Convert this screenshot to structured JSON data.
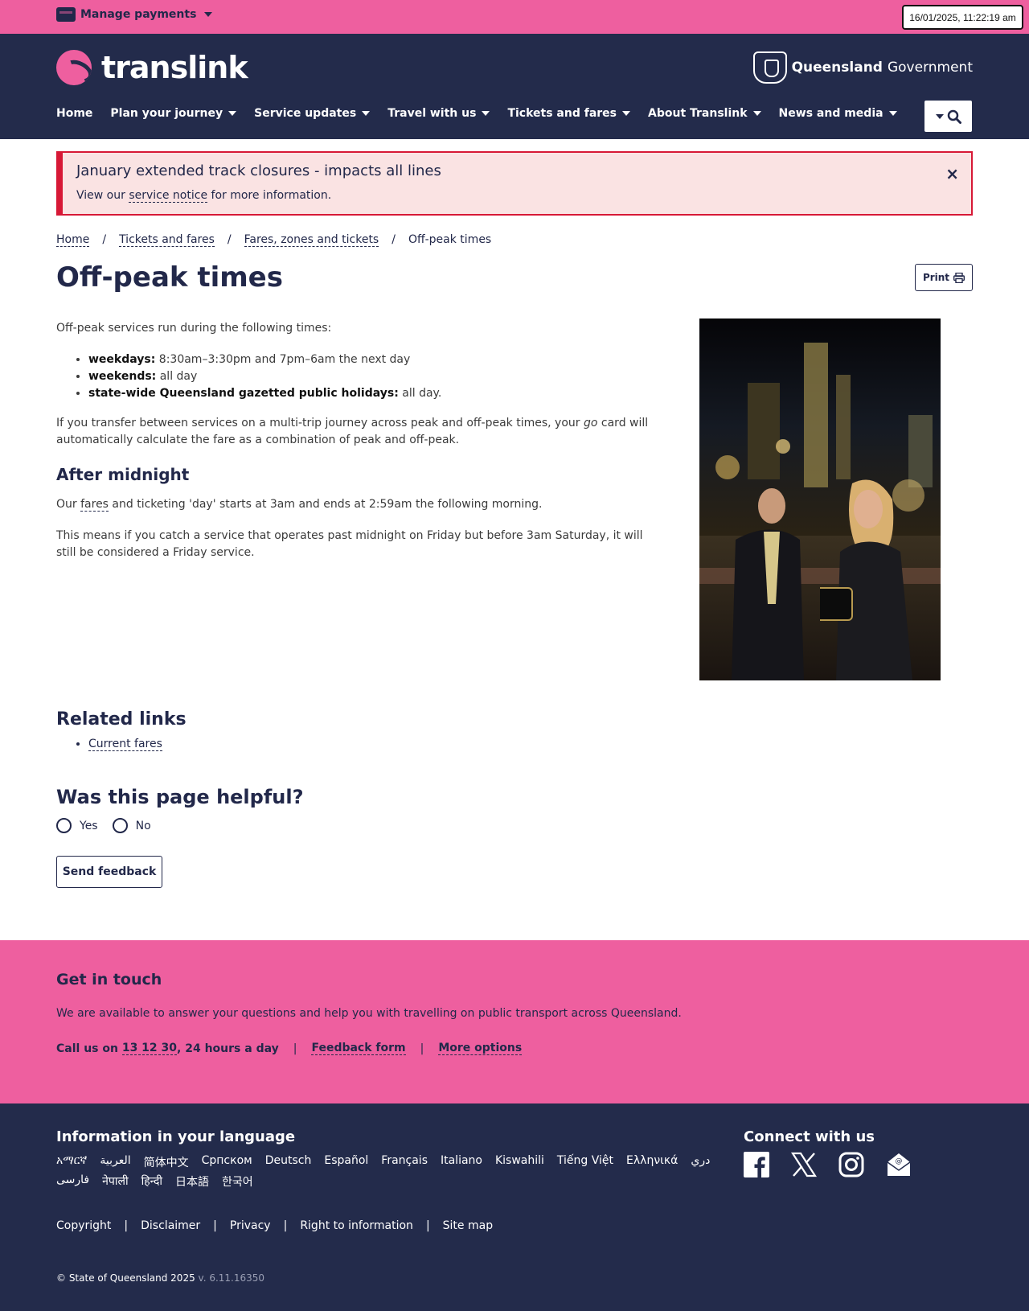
{
  "topbar": {
    "manage_payments": "Manage payments",
    "clock": "16/01/2025, 11:22:19 am"
  },
  "header": {
    "logo_text": "translink",
    "gov_bold": "Queensland",
    "gov_text": "Government",
    "nav": [
      {
        "label": "Home"
      },
      {
        "label": "Plan your journey"
      },
      {
        "label": "Service updates"
      },
      {
        "label": "Travel with us"
      },
      {
        "label": "Tickets and fares"
      },
      {
        "label": "About Translink"
      },
      {
        "label": "News and media"
      }
    ]
  },
  "alert": {
    "title": "January extended track closures - impacts all lines",
    "text_before": "View our ",
    "link": "service notice",
    "text_after": " for more information.",
    "close": "×"
  },
  "breadcrumb": {
    "items": [
      "Home",
      "Tickets and fares",
      "Fares, zones and tickets"
    ],
    "current": "Off-peak times",
    "separator": "/"
  },
  "page": {
    "title": "Off-peak times",
    "print_label": "Print",
    "intro": "Off-peak services run during the following times:",
    "list": [
      {
        "term": "weekdays:",
        "desc": " 8:30am–3:30pm and 7pm–6am the next day"
      },
      {
        "term": "weekends:",
        "desc": " all day"
      },
      {
        "term": "state-wide Queensland gazetted public holidays:",
        "desc": " all day."
      }
    ],
    "transfer_a": "If you transfer between services on a multi-trip journey across peak and off-peak times, your ",
    "transfer_go": "go",
    "transfer_b": " card will automatically calculate the fare as a combination of peak and off-peak.",
    "after_midnight_heading": "After midnight",
    "fares_a": "Our ",
    "fares_link": "fares",
    "fares_b": " and ticketing 'day' starts at 3am and ends at 2:59am the following morning.",
    "friday_text": "This means if you catch a service that operates past midnight on Friday but before 3am Saturday, it will still be considered a Friday service."
  },
  "related": {
    "heading": "Related links",
    "links": [
      "Current fares"
    ]
  },
  "helpful": {
    "heading": "Was this page helpful?",
    "yes": "Yes",
    "no": "No",
    "send_feedback": "Send feedback"
  },
  "touch": {
    "heading": "Get in touch",
    "text": "We are available to answer your questions and help you with travelling on public transport across Queensland.",
    "call_prefix": "Call us on ",
    "call_number": "13 12 30",
    "call_suffix": ", 24 hours a day",
    "feedback_form": "Feedback form",
    "more_options": "More options",
    "separator": "|"
  },
  "footer": {
    "lang_heading": "Information in your language",
    "languages": [
      "አማርኛ",
      "العربية",
      "简体中文",
      "Српском",
      "Deutsch",
      "Español",
      "Français",
      "Italiano",
      "Kiswahili",
      "Tiếng Việt",
      "Ελληνικά",
      "دري",
      "فارسی",
      "नेपाली",
      "हिन्दी",
      "日本語",
      "한국어"
    ],
    "connect_heading": "Connect with us",
    "socials": [
      "facebook-icon",
      "x-icon",
      "instagram-icon",
      "email-icon"
    ],
    "links": [
      "Copyright",
      "Disclaimer",
      "Privacy",
      "Right to information",
      "Site map"
    ],
    "separator": "|",
    "copyright": "© State of Queensland 2025",
    "version": " v. 6.11.16350"
  },
  "colors": {
    "pink": "#ee5f9f",
    "navy": "#232b4b",
    "alert_red": "#d71836",
    "alert_bg": "#fae3e3"
  }
}
